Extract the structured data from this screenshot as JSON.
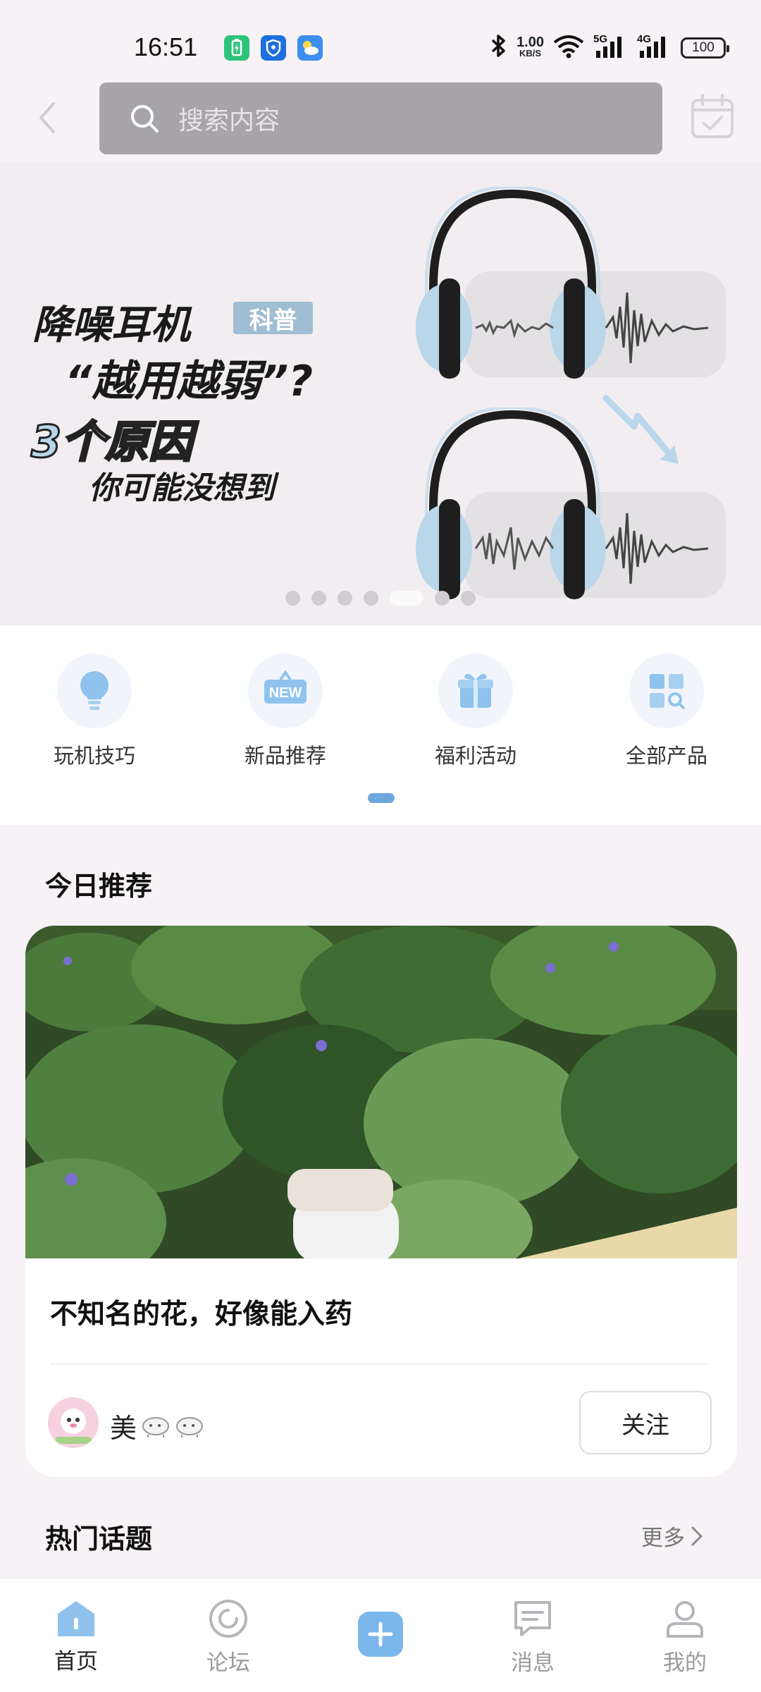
{
  "status_bar": {
    "time": "16:51",
    "net_speed_value": "1.00",
    "net_speed_unit": "KB/S",
    "battery": "100",
    "icons": [
      "battery-saver-icon",
      "shield-icon",
      "weather-icon",
      "bluetooth-icon",
      "wifi-icon",
      "5g-signal-icon",
      "4g-signal-icon"
    ]
  },
  "header": {
    "search_placeholder": "搜索内容",
    "icons": {
      "back": "chevron-left-icon",
      "search": "search-icon",
      "calendar": "calendar-check-icon"
    }
  },
  "banner": {
    "line1": "降噪耳机",
    "tag": "科普",
    "line2": "“越用越弱”?",
    "line3": "3个原因",
    "line4": "你可能没想到",
    "dots_count": 7,
    "active_dot": 4
  },
  "quick_actions": [
    {
      "label": "玩机技巧",
      "icon": "lightbulb-icon"
    },
    {
      "label": "新品推荐",
      "icon": "new-badge-icon"
    },
    {
      "label": "福利活动",
      "icon": "gift-icon"
    },
    {
      "label": "全部产品",
      "icon": "grid-search-icon"
    }
  ],
  "today_recommend": {
    "title": "今日推荐",
    "post_title": "不知名的花，好像能入药",
    "author": "美",
    "author_icons": [
      "sheep-emoji-icon",
      "sheep-emoji-icon"
    ],
    "follow_label": "关注"
  },
  "hot_topics": {
    "title": "热门话题",
    "more_label": "更多"
  },
  "bottom_nav": [
    {
      "label": "首页",
      "icon": "home-icon",
      "active": true
    },
    {
      "label": "论坛",
      "icon": "forum-icon",
      "active": false
    },
    {
      "label": "",
      "icon": "plus-icon",
      "active": false
    },
    {
      "label": "消息",
      "icon": "message-icon",
      "active": false
    },
    {
      "label": "我的",
      "icon": "profile-icon",
      "active": false
    }
  ],
  "colors": {
    "accent_blue": "#6ea7de",
    "search_bg": "#a7a5aa",
    "page_bg": "#f6f2f6"
  }
}
